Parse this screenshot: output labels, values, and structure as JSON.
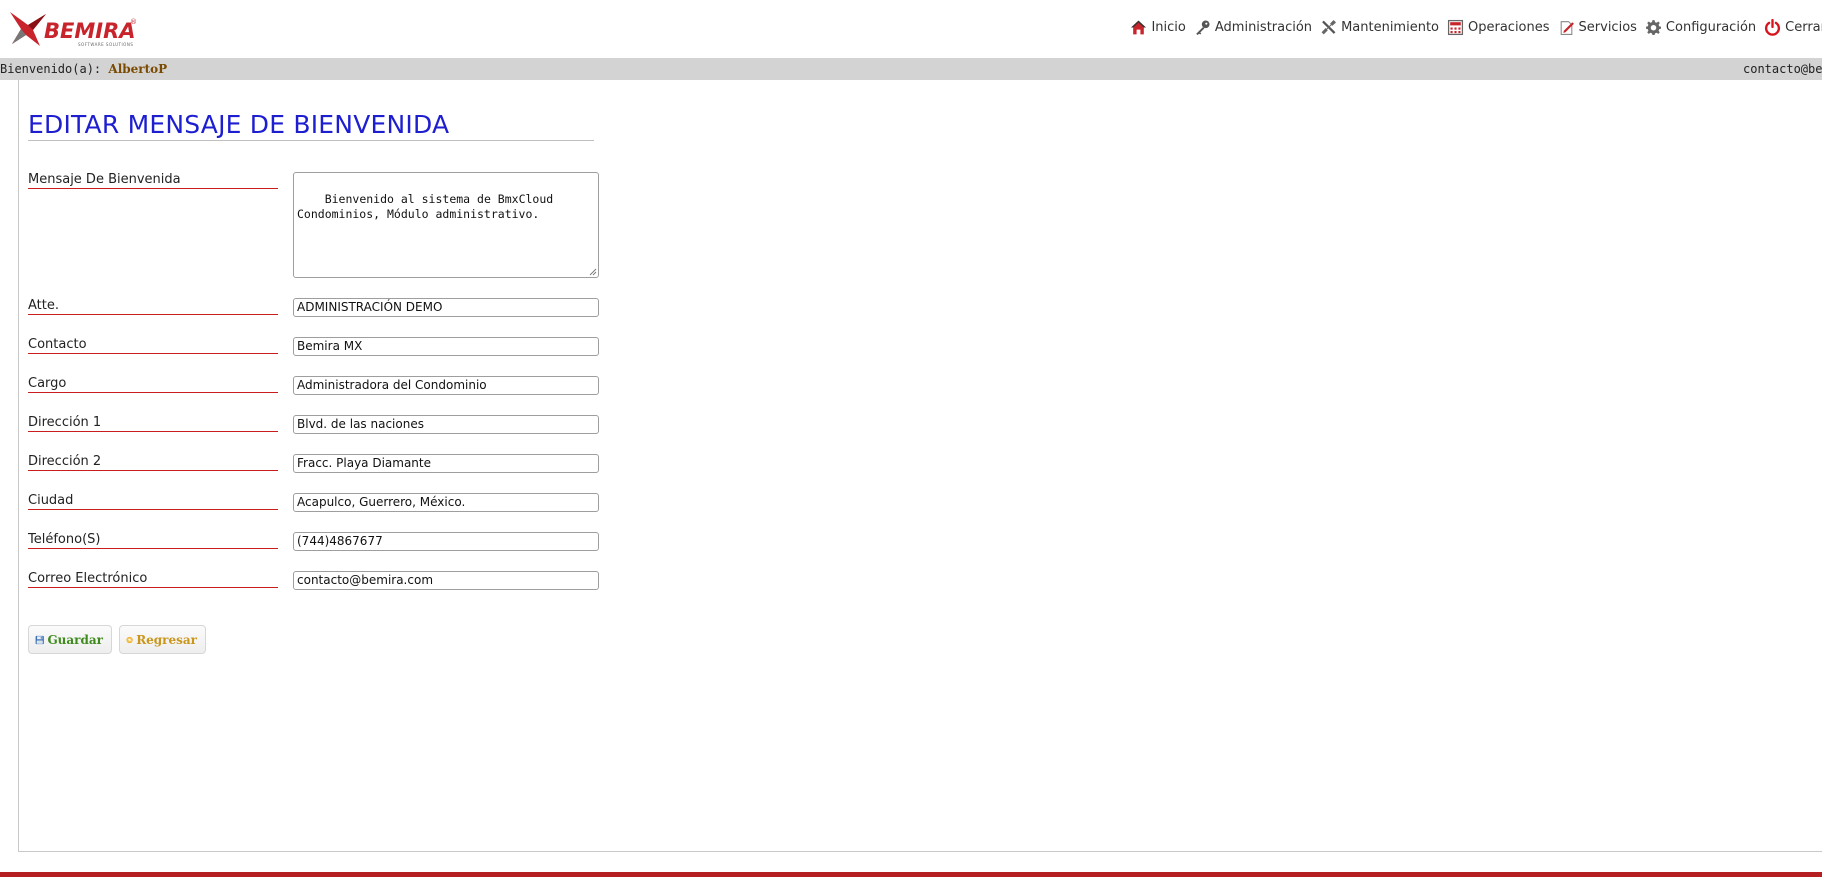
{
  "header": {
    "logo_text": "BEMIRA",
    "logo_subtitle": "SOFTWARE SOLUTIONS",
    "nav": [
      {
        "label": "Inicio",
        "icon": "home-icon"
      },
      {
        "label": "Administración",
        "icon": "key-icon"
      },
      {
        "label": "Mantenimiento",
        "icon": "tools-icon"
      },
      {
        "label": "Operaciones",
        "icon": "calculator-icon"
      },
      {
        "label": "Servicios",
        "icon": "edit-icon"
      },
      {
        "label": "Configuración",
        "icon": "gear-icon"
      },
      {
        "label": "Cerrar",
        "icon": "power-icon"
      }
    ]
  },
  "welcome_bar": {
    "greeting": "Bienvenido(a):",
    "user": "AlbertoP",
    "email": "contacto@bemira.com"
  },
  "form": {
    "title": "EDITAR MENSAJE DE BIENVENIDA",
    "fields": [
      {
        "label": "Mensaje De Bienvenida",
        "value": "Bienvenido al sistema de BmxCloud\nCondominios, Módulo administrativo."
      },
      {
        "label": "Atte.",
        "value": "ADMINISTRACIÓN DEMO"
      },
      {
        "label": "Contacto",
        "value": "Bemira MX"
      },
      {
        "label": "Cargo",
        "value": "Administradora del Condominio"
      },
      {
        "label": "Dirección 1",
        "value": "Blvd. de las naciones"
      },
      {
        "label": "Dirección 2",
        "value": "Fracc. Playa Diamante"
      },
      {
        "label": "Ciudad",
        "value": "Acapulco, Guerrero, México."
      },
      {
        "label": "Teléfono(S)",
        "value": "(744)4867677"
      },
      {
        "label": "Correo Electrónico",
        "value": "contacto@bemira.com"
      }
    ],
    "buttons": {
      "save": "Guardar",
      "back": "Regresar"
    }
  },
  "colors": {
    "title": "#1e1ed1",
    "label_underline": "#c91e1e",
    "footer": "#b51f22",
    "welcome_bar": "#d3d3d3"
  }
}
